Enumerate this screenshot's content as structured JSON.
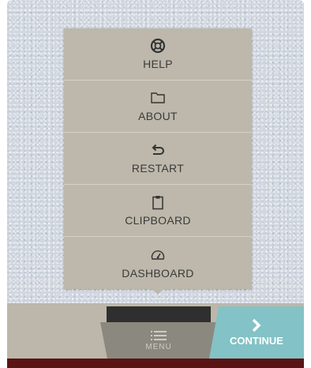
{
  "menu": {
    "items": [
      {
        "label": "HELP",
        "icon": "lifebuoy-icon"
      },
      {
        "label": "ABOUT",
        "icon": "folder-icon"
      },
      {
        "label": "RESTART",
        "icon": "restart-arrow-icon"
      },
      {
        "label": "CLIPBOARD",
        "icon": "clipboard-icon"
      },
      {
        "label": "DASHBOARD",
        "icon": "gauge-icon"
      }
    ]
  },
  "bottom_bar": {
    "menu_label": "MENU",
    "menu_icon": "hamburger-icon",
    "continue_label": "CONTINUE",
    "continue_icon": "chevron-right-icon"
  },
  "colors": {
    "panel": "#bdb8ab",
    "continue": "#83c2c6",
    "menu_button": "#8b897f",
    "footer": "#5a1414"
  }
}
